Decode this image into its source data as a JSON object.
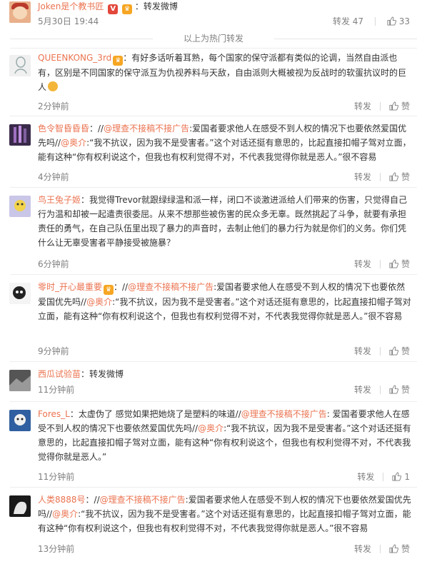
{
  "top_post": {
    "author": "Joken是个教书匠",
    "date": "5月30日 19:44",
    "source": "转发微博",
    "repost_label": "转发",
    "repost_count": "47",
    "like_count": "33"
  },
  "hot_divider": "以上为热门转发",
  "comments": [
    {
      "user": "QUEENKONG_3rd",
      "text": "：有好多话听着耳熟，每个国家的保守派都有类似的论调，当然自由派也有，区别是不同国家的保守派互为仇视养料与天敌，自由派则大概被视为反战时的软蛋抗议时的巨人",
      "time": "2分钟前",
      "repost": "转发",
      "like": "赞"
    },
    {
      "user": "色令智昏昏昏",
      "mid1": "：//",
      "at1": "@理查不接稿不接广告",
      "text1": ":爱国者要求他人在感受不到人权的情况下也要依然爱国优先吗//",
      "at2": "@奥介",
      "text2": ":“我不抗议，因为我不是受害者。”这个对话还挺有意思的，比起直接扣帽子驾对立面，能有这种“你有权利说这个，但我也有权利觉得不对，不代表我觉得你就是恶人。”很不容易",
      "time": "4分钟前",
      "repost": "转发",
      "like": "赞"
    },
    {
      "user": "鸟王兔子姬",
      "text": "：我觉得Trevor就跟绿绿温和派一样，闭口不谈激进派给人们带来的伤害，只觉得自己行为温和却被一起遣责很委屈。从来不想那些被伤害的民众多无辜。既然挑起了斗争，就要有承担责任的勇气，在自己队伍里出现了暴力的声音时，去制止他们的暴力行为就是你们的义务。你们凭什么让无辜受害者平静接受被施暴？",
      "time": "6分钟前",
      "repost": "转发",
      "like": "赞"
    },
    {
      "user": "零时_开心最重要",
      "mid1": "：//",
      "at1": "@理查不接稿不接广告",
      "text1": ":爱国者要求他人在感受不到人权的情况下也要依然爱国优先吗//",
      "at2": "@奥介",
      "text2": ":“我不抗议，因为我不是受害者。”这个对话还挺有意思的，比起直接扣帽子驾对立面，能有这种“你有权利说这个，但我也有权利觉得不对，不代表我觉得你就是恶人。”很不容易",
      "time": "9分钟前",
      "repost": "转发",
      "like": "赞"
    },
    {
      "user": "西瓜试验苗",
      "text": "：转发微博",
      "time": "11分钟前",
      "repost": "转发",
      "like": "赞"
    },
    {
      "user": "Fores_L",
      "pre": "：太虚伪了 感觉如果把她烧了是塑料的味道//",
      "at1": "@理查不接稿不接广告",
      "text1": ": 爱国者要求他人在感受不到人权的情况下也要依然爱国优先吗//",
      "at2": "@奥介",
      "text2": ":“我不抗议，因为我不是受害者。”这个对话还挺有意思的，比起直接扣帽子驾对立面，能有这种“你有权利说这个，但我也有权利觉得不对，不代表我觉得你就是恶人。”",
      "time": "11分钟前",
      "repost": "转发",
      "like": "1"
    },
    {
      "user": "人类8888号",
      "mid1": "：//",
      "at1": "@理查不接稿不接广告",
      "text1": ":爱国者要求他人在感受不到人权的情况下也要依然爱国优先吗//",
      "at2": "@奥介",
      "text2": ":“我不抗议，因为我不是受害者。”这个对话还挺有意思的，比起直接扣帽子驾对立面，能有这种“你有权利说这个，但我也有权利觉得不对，不代表我觉得你就是恶人。”很不容易",
      "time": "13分钟前",
      "repost": "转发",
      "like": "赞"
    }
  ],
  "colors": {
    "link": "#eb7350",
    "meta": "#808080",
    "text": "#333333"
  }
}
